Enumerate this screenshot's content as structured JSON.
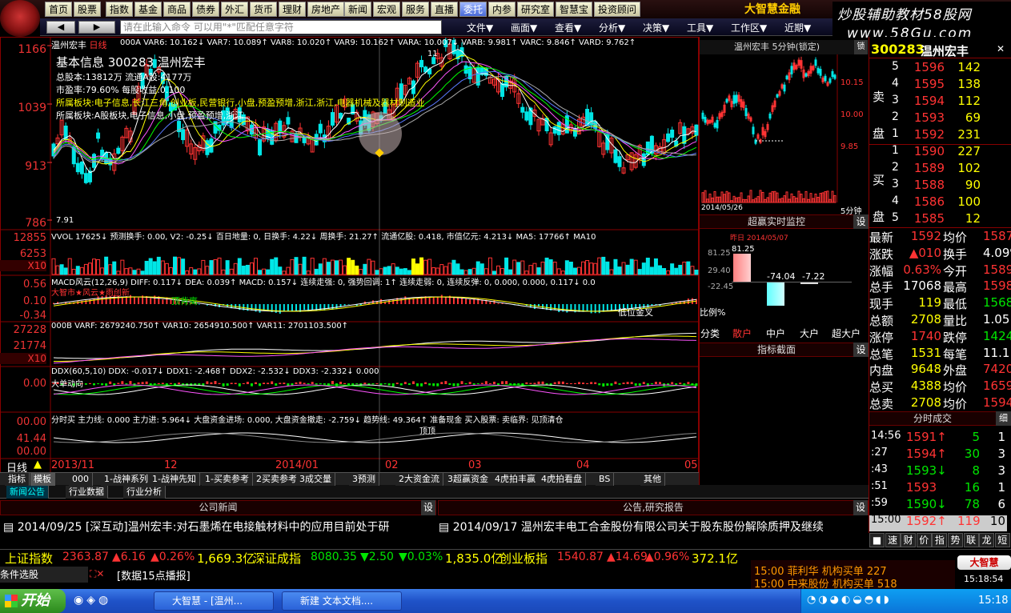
{
  "topnav": {
    "items": [
      "首页",
      "股票",
      "指数",
      "基金",
      "商品",
      "债券",
      "外汇",
      "货币",
      "理财",
      "房地产",
      "新闻",
      "宏观",
      "服务",
      "直播",
      "委托",
      "内参",
      "研究室",
      "智慧宝",
      "投资顾问"
    ],
    "brand": "大智慧金融"
  },
  "watermark": {
    "line1": "炒股辅助教材58股网",
    "line2": "www.58Gu.com"
  },
  "toolbar": {
    "command_placeholder": "请在此输入命令  可以用\"*\"匹配任意字符",
    "menus": [
      "文件▼",
      "画面▼",
      "查看▼",
      "分析▼",
      "决策▼",
      "工具▼",
      "工作区▼",
      "近期▼"
    ]
  },
  "stock": {
    "code": "300283",
    "name": "温州宏丰",
    "period": "日线"
  },
  "kline": {
    "header": "000A VAR6: 10.162↓ VAR7: 10.089↑ VAR8: 10.020↑ VAR9: 10.162↑ VARA: 10.007↓ VARB: 9.981↑ VARC: 9.846↑ VARD: 9.762↑",
    "y_labels": [
      "1166",
      "1039",
      "913",
      "786"
    ],
    "info_title": "基本信息 300283 温州宏丰",
    "info_lines": [
      "总股本:13812万 流通A股:4177万",
      "市盈率:79.60% 每股收益:0.100"
    ],
    "sector1": "所属板块:电子信息,长江三角,创业板,民营银行,小盘,预盈预增,浙江,浙江,电器机械及器材制造业",
    "sector2": "所属板块:A股板块,电子信息,小盘,预盈预增,浙江",
    "low_label": "7.91",
    "high_label": "11"
  },
  "vol": {
    "header_left": "VVOL 17625↓ 预测换手: 0.00, V2: -0.25↓ 百日地量: 0, 日换手: 4.22↓ 周换手: 21.27↑ 流通亿股: 0.418, 市值亿元: 4.213↓ MA5: 17766↑ MA10",
    "y_labels": [
      "12855",
      "6253",
      "X10"
    ]
  },
  "macd": {
    "header": "MACD风云(12,26,9) DIFF: 0.117↓ DEA: 0.039↑ MACD: 0.157↓ 连续走强: 0, 强势回调: 1↑ 连续走弱: 0, 连续反弹: 0, 0.000, 0.000, 0.117↓ 0.0",
    "sub": "大智市★风云★雨创新",
    "y_labels": [
      "0.56",
      "0.10",
      "-0.34"
    ],
    "note1": "顶背离",
    "note2": "低位金叉"
  },
  "vr": {
    "header": "000B VARF: 2679240.750↑ VAR10: 2654910.500↑ VAR11: 2701103.500↑",
    "y_labels": [
      "27228",
      "21774",
      "X10"
    ]
  },
  "ddx": {
    "header": "DDX(60,5,10) DDX: -0.017↓ DDX1: -2.468↑ DDX2: -2.532↓ DDX3: -2.332↓ 0.000",
    "sub": "大单动向",
    "y_labels": [
      "0.00"
    ]
  },
  "fenshi": {
    "header": "分时买 主力线: 0.000 主力进: 5.964↓ 大盘资金进场: 0.000, 大盘资金撤走: -2.759↓ 趋势线: 49.364↑ 准备现金 买入股票: 卖临界: 见顶清仓",
    "y_labels": [
      "00.00",
      "41.44",
      "00.00"
    ],
    "note": "顶顶"
  },
  "xaxis": {
    "period_label": "日线",
    "ticks": [
      "2013/11",
      "12",
      "2014/01",
      "02",
      "03",
      "04",
      "05"
    ]
  },
  "indicator_tabs": [
    "指标",
    "模板",
    "000",
    "1-战神系列",
    "1-战神先知",
    "1-买卖参考",
    "2买卖参考",
    "3成交量",
    "3预测",
    "2大资金流",
    "3超赢资金",
    "4虎拍丰赢",
    "4虎拍看盘",
    "BS",
    "其他"
  ],
  "news_tabs": [
    "新闻公告",
    "行业数据",
    "行业分析"
  ],
  "company_news": {
    "title": "公司新闻",
    "set": "设",
    "item": "2014/09/25 [深互动]温州宏丰:对石墨烯在电接触材料中的应用目前处于研"
  },
  "announce": {
    "title": "公告,研究报告",
    "set": "设",
    "item": "2014/09/17 温州宏丰电工合金股份有限公司关于股东股份解除质押及继续"
  },
  "mini5": {
    "title": "温州宏丰 5分钟(锁定)",
    "y_labels": [
      "10.15",
      "10.00",
      "9.85"
    ],
    "date": "2014/05/26",
    "period": "5分钟",
    "set": "设"
  },
  "monitor": {
    "title": "超赢实时监控",
    "set": "设",
    "date": "昨日 2014/05/07",
    "y_labels": [
      "81.25",
      "29.40",
      "-22.45"
    ],
    "bar_values": [
      "81.25",
      "-74.04",
      "-7.22"
    ],
    "ratio_label": "比例%",
    "categories": [
      "分类",
      "散户",
      "中户",
      "大户",
      "超大户"
    ]
  },
  "indicator_panel": {
    "title": "指标截面",
    "set": "设"
  },
  "quote": {
    "header_code": "300283",
    "header_name": "温州宏丰",
    "sell_label": "卖盘",
    "buy_label": "买盘",
    "sells": [
      {
        "n": "5",
        "p": "1596",
        "v": "142"
      },
      {
        "n": "4",
        "p": "1595",
        "v": "138"
      },
      {
        "n": "3",
        "p": "1594",
        "v": "112"
      },
      {
        "n": "2",
        "p": "1593",
        "v": "69"
      },
      {
        "n": "1",
        "p": "1592",
        "v": "231"
      }
    ],
    "buys": [
      {
        "n": "1",
        "p": "1590",
        "v": "227"
      },
      {
        "n": "2",
        "p": "1589",
        "v": "102"
      },
      {
        "n": "3",
        "p": "1588",
        "v": "90"
      },
      {
        "n": "4",
        "p": "1586",
        "v": "100"
      },
      {
        "n": "5",
        "p": "1585",
        "v": "12"
      }
    ],
    "stats": [
      {
        "l1": "最新",
        "v1": "1592",
        "l2": "均价",
        "v2": "1587"
      },
      {
        "l1": "涨跌",
        "v1": "▲010",
        "l2": "换手",
        "v2": "4.09%"
      },
      {
        "l1": "涨幅",
        "v1": "0.63%",
        "l2": "今开",
        "v2": "1589"
      },
      {
        "l1": "总手",
        "v1": "17068",
        "l2": "最高",
        "v2": "1598"
      },
      {
        "l1": "现手",
        "v1": "119",
        "l2": "最低",
        "v2": "1568"
      },
      {
        "l1": "总额",
        "v1": "2708",
        "l2": "量比",
        "v2": "1.05"
      },
      {
        "l1": "涨停",
        "v1": "1740",
        "l2": "跌停",
        "v2": "1424"
      },
      {
        "l1": "总笔",
        "v1": "1531",
        "l2": "每笔",
        "v2": "11.1"
      },
      {
        "l1": "内盘",
        "v1": "9648",
        "l2": "外盘",
        "v2": "7420"
      },
      {
        "l1": "总买",
        "v1": "4388",
        "l2": "均价",
        "v2": "1659"
      },
      {
        "l1": "总卖",
        "v1": "2708",
        "l2": "均价",
        "v2": "1594"
      }
    ],
    "ticks_title": "分时成交",
    "ticks_tab": "细",
    "ticks": [
      {
        "t": "14:56",
        "p": "1591↑",
        "v": "5",
        "n": "1"
      },
      {
        "t": ":27",
        "p": "1594↑",
        "v": "30",
        "n": "3"
      },
      {
        "t": ":43",
        "p": "1593↓",
        "v": "8",
        "n": "3"
      },
      {
        "t": ":51",
        "p": "1593",
        "v": "16",
        "n": "1"
      },
      {
        "t": ":59",
        "p": "1590↓",
        "v": "78",
        "n": "6"
      },
      {
        "t": "15:00",
        "p": "1592↑",
        "v": "119",
        "n": "10"
      }
    ],
    "bottom_tabs": [
      "■",
      "速",
      "财",
      "价",
      "指",
      "势",
      "联",
      "龙",
      "短"
    ]
  },
  "indexbar": {
    "items": [
      {
        "name": "上证指数",
        "val": "2363.87",
        "chg": "▲6.16",
        "pct": "▲0.26%",
        "amt": "1,669.3亿"
      },
      {
        "name": "深证成指",
        "val": "8080.35",
        "chg": "▼2.50",
        "pct": "▼0.03%",
        "amt": "1,835.0亿"
      },
      {
        "name": "创业板指",
        "val": "1540.87",
        "chg": "▲14.69",
        "pct": "▲0.96%",
        "amt": "372.1亿"
      }
    ]
  },
  "status": {
    "left": "条件选股",
    "data": "[数据15点播报]",
    "alert1": "15:00 菲利华 机构买单 227",
    "alert2": "15:00 中来股份 机构买单 518",
    "logo": "大智慧",
    "time": "15:18:54"
  },
  "taskbar": {
    "start": "开始",
    "tasks": [
      "大智慧 - [温州...",
      "新建 文本文档...."
    ],
    "clock": "15:18"
  },
  "colors": {
    "up": "#ff3333",
    "down": "#00e6e6",
    "bg": "#000000",
    "grid": "#800000"
  }
}
